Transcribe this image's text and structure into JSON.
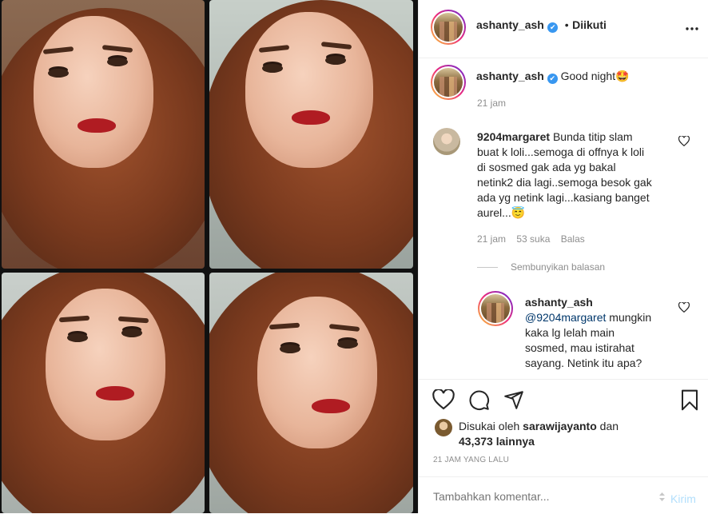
{
  "header": {
    "username": "ashanty_ash",
    "verified_mark": "✔",
    "following_sep": "•",
    "following_label": "Diikuti",
    "more_icon": "more-horizontal-icon"
  },
  "caption": {
    "username": "ashanty_ash",
    "text": "Good night",
    "emoji": "🤩",
    "time": "21 jam"
  },
  "comment": {
    "username": "9204margaret",
    "lines": [
      "Bunda titip slam",
      "buat k loli...semoga di offnya k loli",
      "di sosmed gak ada yg bakal",
      "netink2 dia lagi..semoga besok gak",
      "ada yg netink lagi...kasiang banget",
      "aurel..."
    ],
    "emoji": "😇",
    "time": "21 jam",
    "likes": "53 suka",
    "reply_label": "Balas",
    "hide_replies": "Sembunyikan balasan"
  },
  "reply": {
    "username": "ashanty_ash",
    "mention": "@9204margaret",
    "lines": [
      "mungkin",
      "kaka lg lelah main",
      "sosmed, mau istirahat",
      "sayang. Netink itu apa?"
    ]
  },
  "likes": {
    "prefix": "Disukai oleh",
    "user": "sarawijayanto",
    "conj": "dan",
    "count": "43,373 lainnya"
  },
  "timestamp": "21 JAM YANG LALU",
  "add_comment": {
    "placeholder": "Tambahkan komentar...",
    "send_label": "Kirim"
  },
  "colors": {
    "link": "#00376b",
    "send": "#b2dffc",
    "verified": "#3897f0",
    "lips": "#b01c22"
  }
}
